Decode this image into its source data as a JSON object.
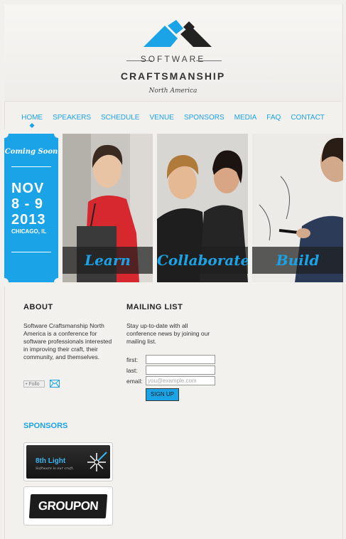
{
  "logo": {
    "software": "SOFTWARE",
    "craftsmanship": "CRAFTSMANSHIP",
    "region": "North America",
    "colors": {
      "blue": "#1aa3e6",
      "dark": "#222222"
    }
  },
  "nav": {
    "items": [
      {
        "label": "HOME",
        "active": true
      },
      {
        "label": "SPEAKERS"
      },
      {
        "label": "SCHEDULE"
      },
      {
        "label": "VENUE"
      },
      {
        "label": "SPONSORS"
      },
      {
        "label": "MEDIA"
      },
      {
        "label": "FAQ"
      },
      {
        "label": "CONTACT"
      }
    ]
  },
  "ticket": {
    "coming_soon": "Coming Soon",
    "month": "NOV",
    "days": "8 - 9",
    "year": "2013",
    "city": "CHICAGO, IL"
  },
  "photos": [
    {
      "caption": "Learn"
    },
    {
      "caption": "Collaborate"
    },
    {
      "caption": "Build"
    }
  ],
  "about": {
    "title": "ABOUT",
    "text": "Software Craftsmanship North America is a conference for software professionals interested in improving their craft, their community, and themselves.",
    "follow_label": "Follo",
    "icons": {
      "follow": "twitter-bird-icon",
      "email": "envelope-icon"
    }
  },
  "mailing_list": {
    "title": "MAILING LIST",
    "text": "Stay up-to-date with all conference news by joining our mailing list.",
    "first_label": "first:",
    "last_label": "last:",
    "email_label": "email:",
    "first_value": "",
    "last_value": "",
    "email_placeholder": "you@example.com",
    "signup_label": "SIGN UP"
  },
  "sponsors": {
    "title": "SPONSORS",
    "items": [
      {
        "name": "8th Light",
        "tagline": "Software is our craft.",
        "logo_icon": "starburst-icon"
      },
      {
        "name": "GROUPON"
      }
    ]
  }
}
